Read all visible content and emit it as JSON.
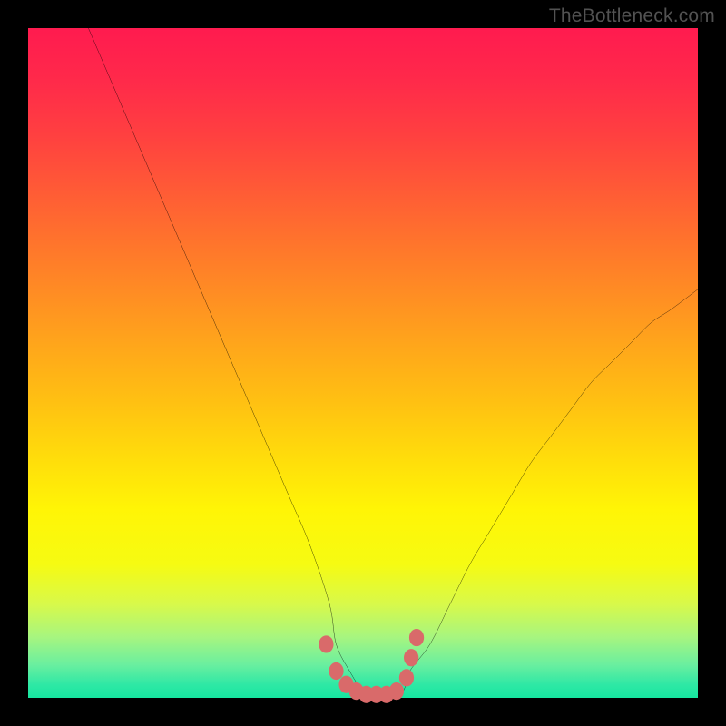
{
  "attribution": "TheBottleneck.com",
  "colors": {
    "frame": "#000000",
    "curve": "#000000",
    "marker": "#d96a6a",
    "gradient_top": "#ff1b4f",
    "gradient_bottom": "#16e6a0"
  },
  "chart_data": {
    "type": "line",
    "title": "",
    "xlabel": "",
    "ylabel": "",
    "xlim": [
      0,
      100
    ],
    "ylim": [
      0,
      100
    ],
    "grid": false,
    "legend": null,
    "note": "Values are percentages of the plot area; y=100 is top (red), y=0 is bottom (green). Curve minimum (bottleneck sweet spot) around x≈47–56 at y≈0.",
    "series": [
      {
        "name": "curve",
        "x": [
          9,
          12,
          15,
          18,
          21,
          24,
          27,
          30,
          33,
          36,
          39,
          42,
          45,
          46,
          48,
          50,
          52,
          54,
          56,
          57,
          60,
          63,
          66,
          69,
          72,
          75,
          78,
          81,
          84,
          87,
          90,
          93,
          96,
          100
        ],
        "y": [
          100,
          93,
          86,
          79,
          72,
          65,
          58,
          51,
          44,
          37,
          30,
          23,
          14,
          8,
          4,
          1,
          0,
          0,
          1,
          4,
          8,
          14,
          20,
          25,
          30,
          35,
          39,
          43,
          47,
          50,
          53,
          56,
          58,
          61
        ]
      }
    ],
    "markers": {
      "name": "highlight-dots",
      "x": [
        44.5,
        46,
        47.5,
        49,
        50.5,
        52,
        53.5,
        55,
        56.5,
        57.2,
        58
      ],
      "y": [
        8,
        4,
        2,
        1,
        0.5,
        0.5,
        0.5,
        1,
        3,
        6,
        9
      ]
    }
  }
}
